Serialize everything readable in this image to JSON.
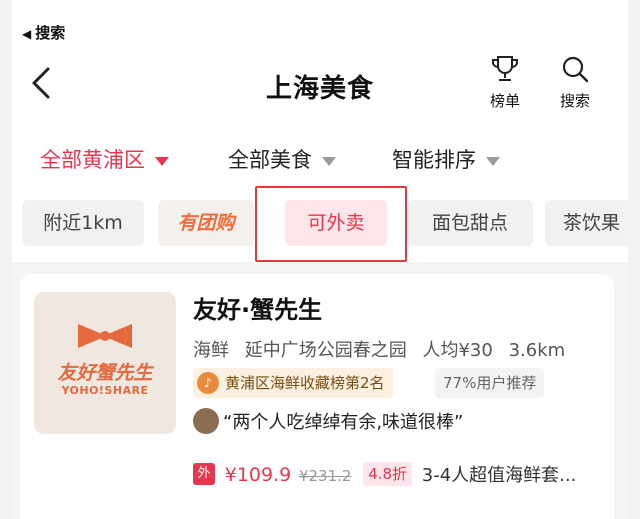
{
  "status_bar": {
    "back_app": "搜索"
  },
  "navbar": {
    "title": "上海美食",
    "rank_label": "榜单",
    "search_label": "搜索"
  },
  "filters": [
    {
      "label": "全部黄浦区",
      "active": true
    },
    {
      "label": "全部美食",
      "active": false
    },
    {
      "label": "智能排序",
      "active": false
    }
  ],
  "chips": {
    "nearby": "附近1km",
    "tuangou": "有团购",
    "waimai": "可外卖",
    "bread": "面包甜点",
    "tea": "茶饮果"
  },
  "shop": {
    "name": "友好·蟹先生",
    "logo_text_cn": "友好蟹先生",
    "logo_text_en": "YOHO!SHARE",
    "category": "海鲜",
    "area": "延中广场公园春之园",
    "avg_price": "人均¥30",
    "distance": "3.6km",
    "rank_badge": "黄浦区海鲜收藏榜第2名",
    "recommend": "77%用户推荐",
    "review": "“两个人吃绰绰有余,味道很棒”",
    "deal": {
      "tag": "外",
      "price": "¥109.9",
      "original": "¥231.2",
      "discount": "4.8折",
      "package": "3-4人超值海鲜套..."
    }
  },
  "colors": {
    "accent": "#e8364f",
    "tuangou": "#f06d3a",
    "logo": "#e4693e",
    "highlight_box": "#e23a3a"
  }
}
